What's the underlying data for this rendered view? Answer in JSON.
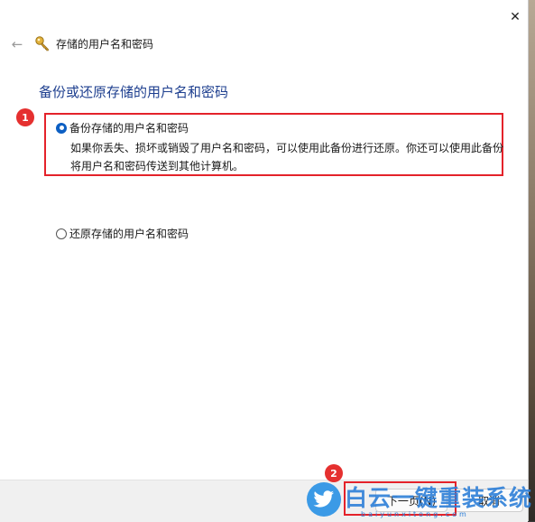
{
  "window": {
    "title": "存储的用户名和密码",
    "close_glyph": "✕",
    "back_glyph": "←"
  },
  "page": {
    "heading": "备份或还原存储的用户名和密码",
    "options": [
      {
        "label": "备份存储的用户名和密码",
        "checked": true,
        "description": "如果你丢失、损坏或销毁了用户名和密码，可以使用此备份进行还原。你还可以使用此备份将用户名和密码传送到其他计算机。"
      },
      {
        "label": "还原存储的用户名和密码",
        "checked": false
      }
    ]
  },
  "annotations": {
    "step1": "1",
    "step2": "2",
    "color": "#e4222a"
  },
  "footer": {
    "next_label": "下一页(N)",
    "cancel_label": "取消"
  },
  "watermark": {
    "text": "白云一键重装系统",
    "url": "baiyunxitong.com"
  },
  "icons": {
    "title": "key-icon",
    "back": "back-arrow-icon",
    "close": "close-icon",
    "watermark": "twitter-bird-icon"
  }
}
